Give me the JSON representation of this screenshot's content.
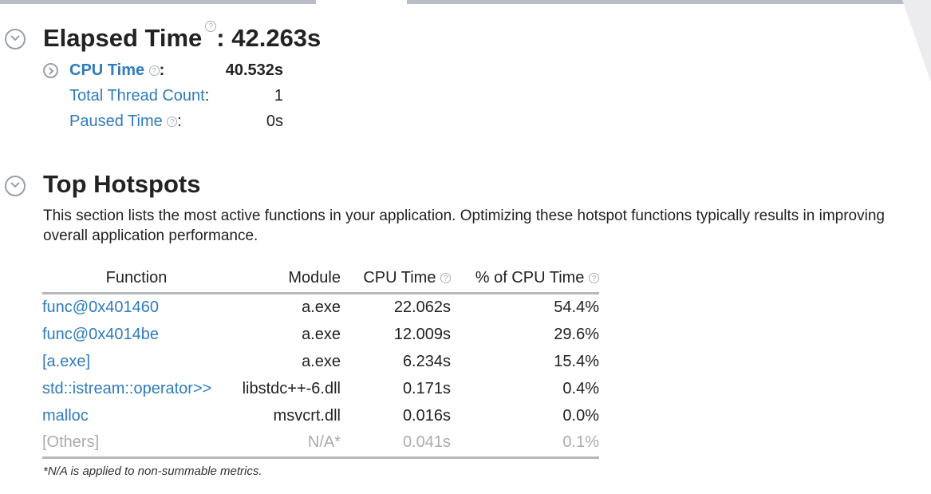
{
  "elapsed": {
    "title": "Elapsed Time",
    "value": ": 42.263s",
    "metrics": [
      {
        "label": "CPU Time",
        "value": "40.532s"
      },
      {
        "label": "Total Thread Count",
        "value": "1"
      },
      {
        "label": "Paused Time",
        "value": "0s"
      }
    ]
  },
  "hotspots": {
    "title": "Top Hotspots",
    "description": "This section lists the most active functions in your application. Optimizing these hotspot functions typically results in improving overall application performance.",
    "columns": [
      "Function",
      "Module",
      "CPU Time",
      "% of CPU Time"
    ],
    "rows": [
      {
        "function": "func@0x401460",
        "module": "a.exe",
        "cpu_time": "22.062s",
        "pct": "54.4%"
      },
      {
        "function": "func@0x4014be",
        "module": "a.exe",
        "cpu_time": "12.009s",
        "pct": "29.6%"
      },
      {
        "function": "[a.exe]",
        "module": "a.exe",
        "cpu_time": "6.234s",
        "pct": "15.4%"
      },
      {
        "function": "std::istream::operator>>",
        "module": "libstdc++-6.dll",
        "cpu_time": "0.171s",
        "pct": "0.4%"
      },
      {
        "function": "malloc",
        "module": "msvcrt.dll",
        "cpu_time": "0.016s",
        "pct": "0.0%"
      },
      {
        "function": "[Others]",
        "module": "N/A*",
        "cpu_time": "0.041s",
        "pct": "0.1%"
      }
    ],
    "footnote": "*N/A is applied to non-summable metrics."
  },
  "colors": {
    "link": "#2f7bbd",
    "rule": "#b5b8bd",
    "muted": "#a9acb0"
  }
}
